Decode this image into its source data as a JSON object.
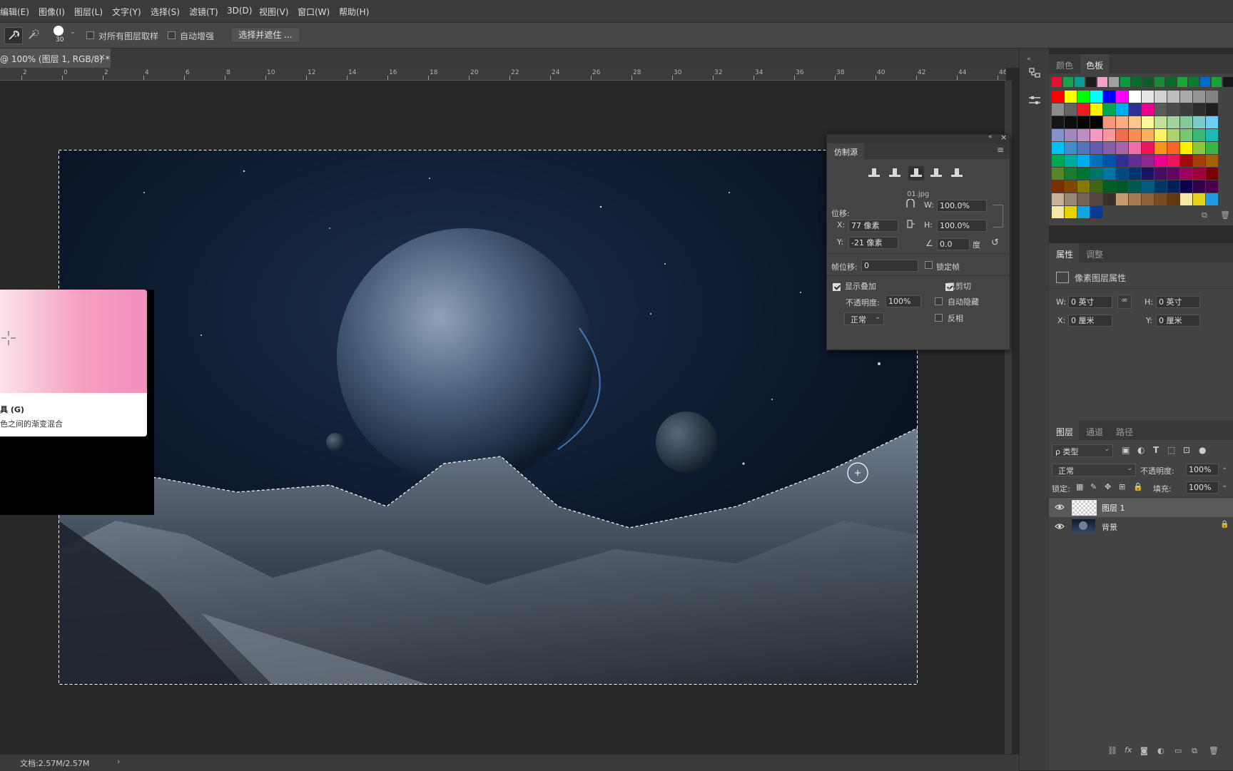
{
  "menu": [
    "编辑(E)",
    "图像(I)",
    "图层(L)",
    "文字(Y)",
    "选择(S)",
    "滤镜(T)",
    "3D(D)",
    "视图(V)",
    "窗口(W)",
    "帮助(H)"
  ],
  "options": {
    "brush_size": "30",
    "sample_all_layers_label": "对所有图层取样",
    "auto_enhance_label": "自动增强",
    "select_and_mask_label": "选择并遮住 ..."
  },
  "document": {
    "tab_title": "@ 100% (图层 1, RGB/8) *",
    "close_glyph": "×"
  },
  "ruler": {
    "ticks": [
      "2",
      "0",
      "2",
      "4",
      "6",
      "8",
      "10",
      "12",
      "14",
      "16",
      "18",
      "20",
      "22",
      "24",
      "26",
      "28",
      "30",
      "32",
      "34",
      "36",
      "38",
      "40",
      "42",
      "44",
      "46"
    ]
  },
  "tooltip": {
    "title": "具 (G)",
    "description": "色之间的渐变混合"
  },
  "status": {
    "doc_size": "文档:2.57M/2.57M",
    "arrow": "›"
  },
  "clone_source": {
    "title": "仿制源",
    "filename": "01.jpg",
    "offset_label": "位移:",
    "x_label": "X:",
    "x_value": "77 像素",
    "y_label": "Y:",
    "y_value": "-21 像素",
    "w_label": "W:",
    "w_value": "100.0%",
    "h_label": "H:",
    "h_value": "100.0%",
    "angle_value": "0.0",
    "angle_unit": "度",
    "frame_offset_label": "帧位移:",
    "frame_offset_value": "0",
    "lock_frame_label": "锁定帧",
    "show_overlay_label": "显示叠加",
    "show_overlay_checked": true,
    "opacity_label": "不透明度:",
    "opacity_value": "100%",
    "blend_mode": "正常",
    "clipped_label": "已剪切",
    "clipped_checked": true,
    "auto_hide_label": "自动隐藏",
    "auto_hide_checked": false,
    "invert_label": "反相",
    "invert_checked": false
  },
  "color_panel": {
    "tabs": [
      "颜色",
      "色板"
    ],
    "active_tab": "色板",
    "swatch_rows": [
      [
        "#e8112d",
        "#1aa04a",
        "#0a9b96",
        "#1c1c1c",
        "#f3a1c4",
        "#a0a0a0",
        "#0a9b3a",
        "#0a6b2a",
        "#0f5c28",
        "#1c8a34",
        "#0c6a28",
        "#1ea53a",
        "#0c7c2e",
        "#0068c8",
        "#1aa23a",
        "#181818",
        "#1fc02e",
        "#1e1e1e"
      ],
      [
        "#ff0000",
        "#ffff00",
        "#00ff00",
        "#00ffff",
        "#0000ff",
        "#ff00ff",
        "#ffffff",
        "#e6e6e6",
        "#d2d2d2",
        "#bebebe",
        "#aaaaaa",
        "#969696",
        "#828282"
      ],
      [
        "#8c8c8c",
        "#646464",
        "#ed1c24",
        "#fff200",
        "#00a651",
        "#00aeef",
        "#2e3192",
        "#ec008c",
        "#5a5a5a",
        "#4b4b4b",
        "#3c3c3c",
        "#2d2d2d",
        "#1e1e1e"
      ],
      [
        "#151515",
        "#0d0d0d",
        "#050505",
        "#000000",
        "#f7977a",
        "#f9ad81",
        "#fdc68a",
        "#fff79a",
        "#c4df9b",
        "#a3d39c",
        "#82ca9d",
        "#7bcdc8",
        "#6ecff6"
      ],
      [
        "#8493ca",
        "#a187be",
        "#bc8dbf",
        "#f49ac2",
        "#f6989d",
        "#f26c4f",
        "#f68e55",
        "#fbaf5c",
        "#fff467",
        "#acd372",
        "#7cc576",
        "#3bb878",
        "#1abbb4"
      ],
      [
        "#00bff3",
        "#438cca",
        "#5574b9",
        "#605ca8",
        "#855fa8",
        "#a763a8",
        "#f06eaa",
        "#ed145b",
        "#f7941d",
        "#f26522",
        "#fff200",
        "#8dc63f",
        "#39b54a"
      ],
      [
        "#00a651",
        "#00a99d",
        "#00aeef",
        "#0072bc",
        "#0054a6",
        "#2e3192",
        "#662d91",
        "#92278f",
        "#ec008c",
        "#ed145b",
        "#9e0b0f",
        "#a0410d",
        "#a36209"
      ],
      [
        "#598527",
        "#1a7b30",
        "#007236",
        "#00746b",
        "#0076a3",
        "#004a80",
        "#003471",
        "#1b1464",
        "#440e62",
        "#630460",
        "#9e005d",
        "#9e0039",
        "#790000"
      ],
      [
        "#7b2e00",
        "#7d4900",
        "#827b00",
        "#406618",
        "#005e20",
        "#005826",
        "#005952",
        "#005b7f",
        "#003663",
        "#002157",
        "#0d004c",
        "#32004b",
        "#4b0049"
      ],
      [
        "#c7b299",
        "#998675",
        "#736357",
        "#534741",
        "#37302d",
        "#c69c6d",
        "#a67c52",
        "#8c6239",
        "#754c24",
        "#603913",
        "#f5e6a1",
        "#e2d21c",
        "#1f9be0"
      ],
      [
        "#f5e8a6",
        "#e6d300",
        "#12a6e0",
        "#0a3a8f"
      ]
    ]
  },
  "properties_panel": {
    "tabs": [
      "属性",
      "调整"
    ],
    "active_tab": "属性",
    "heading": "像素图层属性",
    "w_label": "W:",
    "w_value": "0 英寸",
    "h_label": "H:",
    "h_value": "0 英寸",
    "x_label": "X:",
    "x_value": "0 厘米",
    "y_label": "Y:",
    "y_value": "0 厘米"
  },
  "layers_panel": {
    "tabs": [
      "图层",
      "通道",
      "路径"
    ],
    "active_tab": "图层",
    "filter_label": "ρ 类型",
    "blend_mode": "正常",
    "opacity_label": "不透明度:",
    "opacity_value": "100%",
    "lock_label": "锁定:",
    "fill_label": "填充:",
    "fill_value": "100%",
    "layers": [
      {
        "name": "图层 1",
        "selected": true,
        "locked": false
      },
      {
        "name": "背景",
        "selected": false,
        "locked": true
      }
    ]
  }
}
